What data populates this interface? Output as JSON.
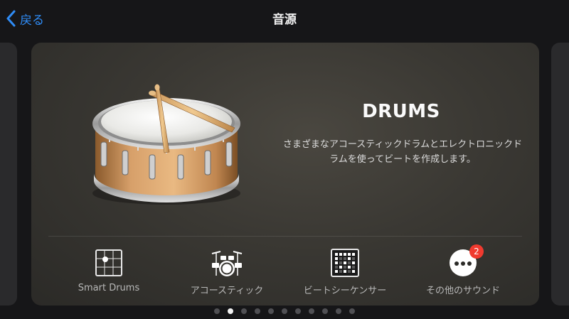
{
  "nav": {
    "back_label": "戻る",
    "title": "音源"
  },
  "card": {
    "title": "DRUMS",
    "description": "さまざまなアコースティックドラムとエレクトロニックドラムを使ってビートを作成します。"
  },
  "tiles": [
    {
      "label": "Smart Drums",
      "icon": "smart-drums-grid-icon"
    },
    {
      "label": "アコースティック",
      "icon": "drum-kit-icon"
    },
    {
      "label": "ビートシーケンサー",
      "icon": "beat-sequencer-icon"
    },
    {
      "label": "その他のサウンド",
      "icon": "more-dots-icon",
      "badge": "2"
    }
  ],
  "pager": {
    "count": 11,
    "active_index": 1
  },
  "colors": {
    "accent": "#2f8cf6",
    "badge": "#f03a2f",
    "background": "#161618"
  }
}
